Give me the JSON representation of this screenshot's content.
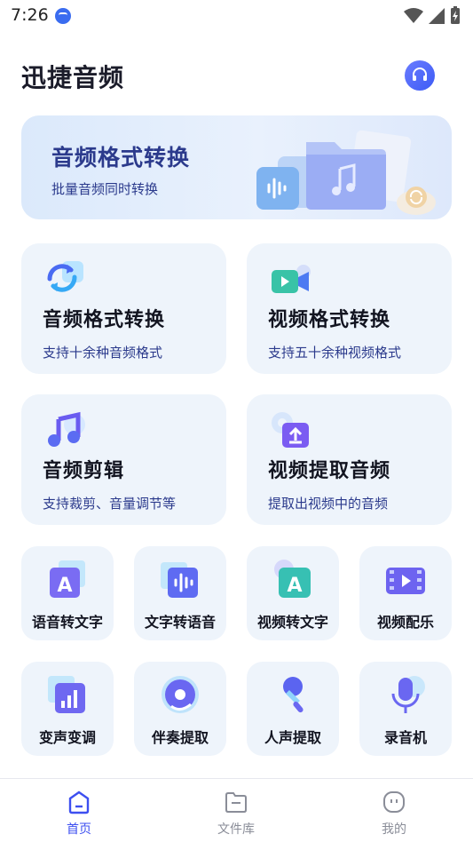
{
  "status_bar": {
    "time": "7:26"
  },
  "header": {
    "title": "迅捷音频"
  },
  "banner": {
    "title": "音频格式转换",
    "subtitle": "批量音频同时转换"
  },
  "cards": [
    {
      "title": "音频格式转换",
      "subtitle": "支持十余种音频格式",
      "icon": "audio-convert-icon"
    },
    {
      "title": "视频格式转换",
      "subtitle": "支持五十余种视频格式",
      "icon": "video-camera-icon"
    },
    {
      "title": "音频剪辑",
      "subtitle": "支持裁剪、音量调节等",
      "icon": "music-note-icon"
    },
    {
      "title": "视频提取音频",
      "subtitle": "提取出视频中的音频",
      "icon": "extract-audio-icon"
    }
  ],
  "tools_row1": [
    {
      "label": "语音转文字",
      "icon": "speech-to-text-icon"
    },
    {
      "label": "文字转语音",
      "icon": "text-to-speech-icon"
    },
    {
      "label": "视频转文字",
      "icon": "video-to-text-icon"
    },
    {
      "label": "视频配乐",
      "icon": "film-strip-icon"
    }
  ],
  "tools_row2": [
    {
      "label": "变声变调",
      "icon": "voice-change-icon"
    },
    {
      "label": "伴奏提取",
      "icon": "vinyl-disc-icon"
    },
    {
      "label": "人声提取",
      "icon": "microphone-icon"
    },
    {
      "label": "录音机",
      "icon": "recorder-icon"
    }
  ],
  "bottom_nav": [
    {
      "label": "首页",
      "active": true
    },
    {
      "label": "文件库",
      "active": false
    },
    {
      "label": "我的",
      "active": false
    }
  ],
  "colors": {
    "accent": "#3d4ff0",
    "card_bg": "#eef4fb",
    "subtitle": "#2b3a8c"
  }
}
